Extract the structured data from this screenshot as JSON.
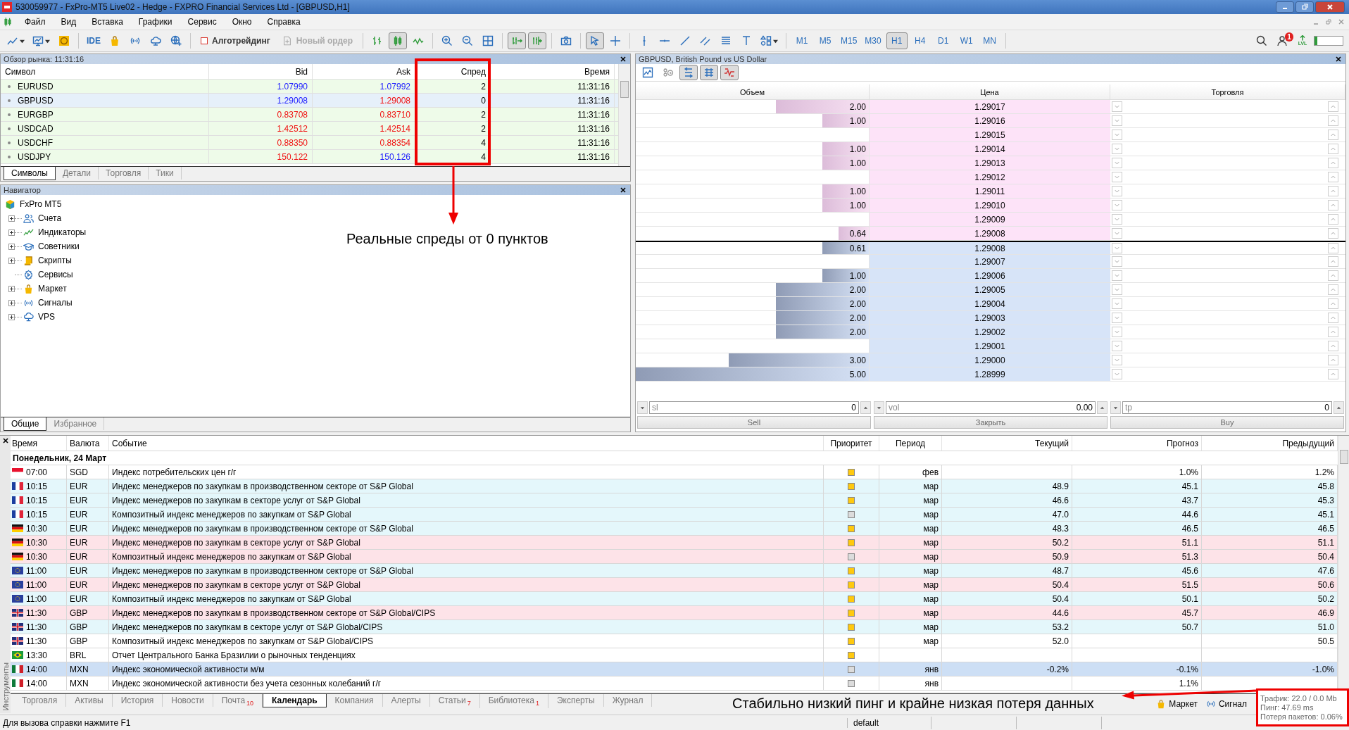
{
  "window": {
    "title": "530059977 - FxPro-MT5 Live02 - Hedge - FXPRO Financial Services Ltd - [GBPUSD,H1]"
  },
  "menu": [
    "Файл",
    "Вид",
    "Вставка",
    "Графики",
    "Сервис",
    "Окно",
    "Справка"
  ],
  "toolbar": {
    "ide": "IDE",
    "algo": {
      "label": "Алготрейдинг",
      "on": false
    },
    "new_order": {
      "label": "Новый ордер",
      "disabled": true
    },
    "chart_type_buttons": [
      {
        "pressed": false
      },
      {
        "pressed": true
      },
      {
        "pressed": false
      }
    ],
    "scroll_buttons": [
      {
        "pressed": true
      },
      {
        "pressed": true
      }
    ],
    "cursor_buttons": [
      {
        "pressed": true
      },
      {
        "pressed": false
      }
    ],
    "timeframes": [
      {
        "label": "M1",
        "selected": false
      },
      {
        "label": "M5",
        "selected": false
      },
      {
        "label": "M15",
        "selected": false
      },
      {
        "label": "M30",
        "selected": false
      },
      {
        "label": "H1",
        "selected": true
      },
      {
        "label": "H4",
        "selected": false
      },
      {
        "label": "D1",
        "selected": false
      },
      {
        "label": "W1",
        "selected": false
      },
      {
        "label": "MN",
        "selected": false
      }
    ],
    "notifications": "1",
    "lvl": "LVL"
  },
  "market_watch": {
    "title": "Обзор рынка: 11:31:16",
    "columns": [
      "Символ",
      "Bid",
      "Ask",
      "Спред",
      "Время"
    ],
    "rows": [
      {
        "symbol": "EURUSD",
        "bid": "1.07990",
        "ask": "1.07992",
        "spread": "2",
        "time": "11:31:16",
        "bid_rising": true,
        "ask_rising": true,
        "selected": false
      },
      {
        "symbol": "GBPUSD",
        "bid": "1.29008",
        "ask": "1.29008",
        "spread": "0",
        "time": "11:31:16",
        "bid_rising": true,
        "ask_rising": false,
        "selected": true
      },
      {
        "symbol": "EURGBP",
        "bid": "0.83708",
        "ask": "0.83710",
        "spread": "2",
        "time": "11:31:16",
        "bid_rising": false,
        "ask_rising": false,
        "selected": false
      },
      {
        "symbol": "USDCAD",
        "bid": "1.42512",
        "ask": "1.42514",
        "spread": "2",
        "time": "11:31:16",
        "bid_rising": false,
        "ask_rising": false,
        "selected": false
      },
      {
        "symbol": "USDCHF",
        "bid": "0.88350",
        "ask": "0.88354",
        "spread": "4",
        "time": "11:31:16",
        "bid_rising": false,
        "ask_rising": false,
        "selected": false
      },
      {
        "symbol": "USDJPY",
        "bid": "150.122",
        "ask": "150.126",
        "spread": "4",
        "time": "11:31:16",
        "bid_rising": false,
        "ask_rising": true,
        "selected": false
      }
    ],
    "tabs": [
      {
        "label": "Символы",
        "selected": true
      },
      {
        "label": "Детали",
        "selected": false
      },
      {
        "label": "Торговля",
        "selected": false
      },
      {
        "label": "Тики",
        "selected": false
      }
    ]
  },
  "navigator": {
    "title": "Навигатор",
    "root": "FxPro MT5",
    "items": [
      {
        "label": "Счета",
        "expandable": true
      },
      {
        "label": "Индикаторы",
        "expandable": true
      },
      {
        "label": "Советники",
        "expandable": true
      },
      {
        "label": "Скрипты",
        "expandable": true
      },
      {
        "label": "Сервисы",
        "expandable": false
      },
      {
        "label": "Маркет",
        "expandable": true
      },
      {
        "label": "Сигналы",
        "expandable": true
      },
      {
        "label": "VPS",
        "expandable": true
      }
    ],
    "tabs": [
      {
        "label": "Общие",
        "selected": true
      },
      {
        "label": "Избранное",
        "selected": false
      }
    ]
  },
  "depth_of_market": {
    "title": "GBPUSD, British Pound vs US Dollar",
    "buttons": [
      {
        "pressed": false
      },
      {
        "pressed": false
      },
      {
        "pressed": true
      },
      {
        "pressed": true
      },
      {
        "pressed": true
      }
    ],
    "columns": [
      "Объем",
      "Цена",
      "Торговля"
    ],
    "rows": [
      {
        "kind": "sell",
        "volume": "2.00",
        "level": 0.4,
        "price": "1.29017"
      },
      {
        "kind": "sell",
        "volume": "1.00",
        "level": 0.2,
        "price": "1.29016"
      },
      {
        "kind": "sell",
        "price": "1.29015"
      },
      {
        "kind": "sell",
        "volume": "1.00",
        "level": 0.2,
        "price": "1.29014"
      },
      {
        "kind": "sell",
        "volume": "1.00",
        "level": 0.2,
        "price": "1.29013"
      },
      {
        "kind": "sell",
        "price": "1.29012"
      },
      {
        "kind": "sell",
        "volume": "1.00",
        "level": 0.2,
        "price": "1.29011"
      },
      {
        "kind": "sell",
        "volume": "1.00",
        "level": 0.2,
        "price": "1.29010"
      },
      {
        "kind": "sell",
        "price": "1.29009"
      },
      {
        "kind": "sell",
        "volume": "0.64",
        "level": 0.13,
        "price": "1.29008"
      },
      {
        "kind": "buy",
        "volume": "0.61",
        "level": 0.2,
        "price": "1.29008"
      },
      {
        "kind": "buy",
        "price": "1.29007"
      },
      {
        "kind": "buy",
        "volume": "1.00",
        "level": 0.2,
        "price": "1.29006"
      },
      {
        "kind": "buy",
        "volume": "2.00",
        "level": 0.4,
        "price": "1.29005"
      },
      {
        "kind": "buy",
        "volume": "2.00",
        "level": 0.4,
        "price": "1.29004"
      },
      {
        "kind": "buy",
        "volume": "2.00",
        "level": 0.4,
        "price": "1.29003"
      },
      {
        "kind": "buy",
        "volume": "2.00",
        "level": 0.4,
        "price": "1.29002"
      },
      {
        "kind": "buy",
        "price": "1.29001"
      },
      {
        "kind": "buy",
        "volume": "3.00",
        "level": 0.6,
        "price": "1.29000"
      },
      {
        "kind": "buy",
        "volume": "5.00",
        "level": 1,
        "price": "1.28999"
      }
    ],
    "fields": [
      {
        "label": "sl",
        "value": "0"
      },
      {
        "label": "vol",
        "value": "0.00"
      },
      {
        "label": "tp",
        "value": "0"
      }
    ],
    "actions": [
      "Sell",
      "Закрыть",
      "Buy"
    ]
  },
  "calendar": {
    "side_label": "Инструменты",
    "columns": [
      "Время",
      "Валюта",
      "Событие",
      "Приоритет",
      "Период",
      "Текущий",
      "Прогноз",
      "Предыдущий"
    ],
    "date": "Понедельник, 24 Март",
    "rows": [
      {
        "time": "07:00",
        "currency": "SGD",
        "event": "Индекс потребительских цен г/г",
        "color": "#ffc90e",
        "period": "фев",
        "forecast": "1.0%",
        "previous": "1.2%",
        "kind": "plain",
        "selected": false
      },
      {
        "time": "10:15",
        "currency": "EUR",
        "event": "Индекс менеджеров по закупкам в производственном секторе от S&P Global",
        "color": "#ffc90e",
        "period": "мар",
        "actual": "48.9",
        "forecast": "45.1",
        "previous": "45.8",
        "kind": "better",
        "selected": false
      },
      {
        "time": "10:15",
        "currency": "EUR",
        "event": "Индекс менеджеров по закупкам в секторе услуг от S&P Global",
        "color": "#ffc90e",
        "period": "мар",
        "actual": "46.6",
        "forecast": "43.7",
        "previous": "45.3",
        "kind": "better",
        "selected": false
      },
      {
        "time": "10:15",
        "currency": "EUR",
        "event": "Композитный индекс менеджеров по закупкам от S&P Global",
        "color": "#dcdcdc",
        "period": "мар",
        "actual": "47.0",
        "forecast": "44.6",
        "previous": "45.1",
        "kind": "better",
        "selected": false
      },
      {
        "time": "10:30",
        "currency": "EUR",
        "event": "Индекс менеджеров по закупкам в производственном секторе от S&P Global",
        "color": "#ffc90e",
        "period": "мар",
        "actual": "48.3",
        "forecast": "46.5",
        "previous": "46.5",
        "kind": "better",
        "selected": false
      },
      {
        "time": "10:30",
        "currency": "EUR",
        "event": "Индекс менеджеров по закупкам в секторе услуг от S&P Global",
        "color": "#ffc90e",
        "period": "мар",
        "actual": "50.2",
        "forecast": "51.1",
        "previous": "51.1",
        "kind": "worse",
        "selected": false
      },
      {
        "time": "10:30",
        "currency": "EUR",
        "event": "Композитный индекс менеджеров по закупкам от S&P Global",
        "color": "#dcdcdc",
        "period": "мар",
        "actual": "50.9",
        "forecast": "51.3",
        "previous": "50.4",
        "kind": "worse",
        "selected": false
      },
      {
        "time": "11:00",
        "currency": "EUR",
        "event": "Индекс менеджеров по закупкам в производственном секторе от S&P Global",
        "color": "#ffc90e",
        "period": "мар",
        "actual": "48.7",
        "forecast": "45.6",
        "previous": "47.6",
        "kind": "better",
        "selected": false
      },
      {
        "time": "11:00",
        "currency": "EUR",
        "event": "Индекс менеджеров по закупкам в секторе услуг от S&P Global",
        "color": "#ffc90e",
        "period": "мар",
        "actual": "50.4",
        "forecast": "51.5",
        "previous": "50.6",
        "kind": "worse",
        "selected": false
      },
      {
        "time": "11:00",
        "currency": "EUR",
        "event": "Композитный индекс менеджеров по закупкам от S&P Global",
        "color": "#ffc90e",
        "period": "мар",
        "actual": "50.4",
        "forecast": "50.1",
        "previous": "50.2",
        "kind": "better",
        "selected": false
      },
      {
        "time": "11:30",
        "currency": "GBP",
        "event": "Индекс менеджеров по закупкам в производственном секторе от S&P Global/CIPS",
        "color": "#ffc90e",
        "period": "мар",
        "actual": "44.6",
        "forecast": "45.7",
        "previous": "46.9",
        "kind": "worse",
        "selected": false
      },
      {
        "time": "11:30",
        "currency": "GBP",
        "event": "Индекс менеджеров по закупкам в секторе услуг от S&P Global/CIPS",
        "color": "#ffc90e",
        "period": "мар",
        "actual": "53.2",
        "forecast": "50.7",
        "previous": "51.0",
        "kind": "better",
        "selected": false
      },
      {
        "time": "11:30",
        "currency": "GBP",
        "event": "Композитный индекс менеджеров по закупкам от S&P Global/CIPS",
        "color": "#ffc90e",
        "period": "мар",
        "actual": "52.0",
        "previous": "50.5",
        "kind": "plain",
        "selected": false
      },
      {
        "time": "13:30",
        "currency": "BRL",
        "event": "Отчет Центрального Банка Бразилии о рыночных тенденциях",
        "color": "#ffc90e",
        "kind": "plain",
        "selected": false
      },
      {
        "time": "14:00",
        "currency": "MXN",
        "event": "Индекс экономической активности м/м",
        "color": "#dcdcdc",
        "period": "янв",
        "actual": "-0.2%",
        "forecast": "-0.1%",
        "previous": "-1.0%",
        "selected": true
      },
      {
        "time": "14:00",
        "currency": "MXN",
        "event": "Индекс экономической активности без учета сезонных колебаний г/г",
        "color": "#dcdcdc",
        "period": "янв",
        "forecast": "1.1%",
        "kind": "plain",
        "selected": false
      }
    ]
  },
  "bottom_tabs": [
    {
      "label": "Торговля",
      "selected": false
    },
    {
      "label": "Активы",
      "selected": false
    },
    {
      "label": "История",
      "selected": false
    },
    {
      "label": "Новости",
      "selected": false
    },
    {
      "label": "Почта",
      "badge": "10",
      "selected": false
    },
    {
      "label": "Календарь",
      "selected": true
    },
    {
      "label": "Компания",
      "selected": false
    },
    {
      "label": "Алерты",
      "selected": false
    },
    {
      "label": "Статьи",
      "badge": "7",
      "selected": false
    },
    {
      "label": "Библиотека",
      "badge": "1",
      "selected": false
    },
    {
      "label": "Эксперты",
      "selected": false
    },
    {
      "label": "Журнал",
      "selected": false
    }
  ],
  "bottom_links": [
    "Маркет",
    "Сигнал"
  ],
  "status_bar": {
    "help": "Для вызова справки нажмите F1",
    "profile": "default"
  },
  "annotations": {
    "spread_note": "Реальные спреды от 0 пунктов",
    "ping_note": "Стабильно низкий пинг и крайне низкая потеря данных",
    "connection_tooltip": [
      "Трафик: 22.0 / 0.0 Mb",
      "Пинг: 47.69 ms",
      "Потеря пакетов: 0.06%"
    ]
  }
}
